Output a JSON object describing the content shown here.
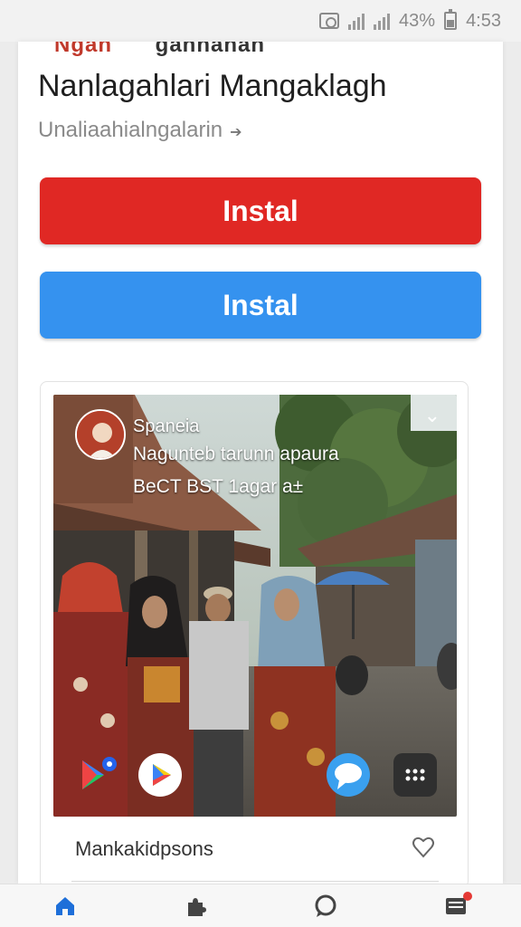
{
  "status_bar": {
    "battery_text": "43%",
    "time": "4:53"
  },
  "header": {
    "cut_text_left": "Ngan",
    "cut_text_right": "gannahan",
    "title": "Nanlagahlari Mangaklagh",
    "subtitle": "Unaliaahialngalarin"
  },
  "buttons": {
    "primary_label": "Instal",
    "secondary_label": "Instal"
  },
  "media": {
    "channel_name": "Spaneia",
    "line1": "Nagunteb tarunn apaura",
    "line2": "BeCT BST 1agar a±"
  },
  "search": {
    "placeholder": "Mankakidpsons"
  },
  "colors": {
    "primary_button": "#e02824",
    "secondary_button": "#3592ef",
    "nav_active": "#1e6fd9"
  },
  "icons": {
    "nav": [
      "home-icon",
      "puzzle-icon",
      "chat-icon",
      "menu-icon"
    ],
    "media": [
      "store-icon",
      "play-icon",
      "message-icon",
      "keyboard-icon"
    ]
  }
}
